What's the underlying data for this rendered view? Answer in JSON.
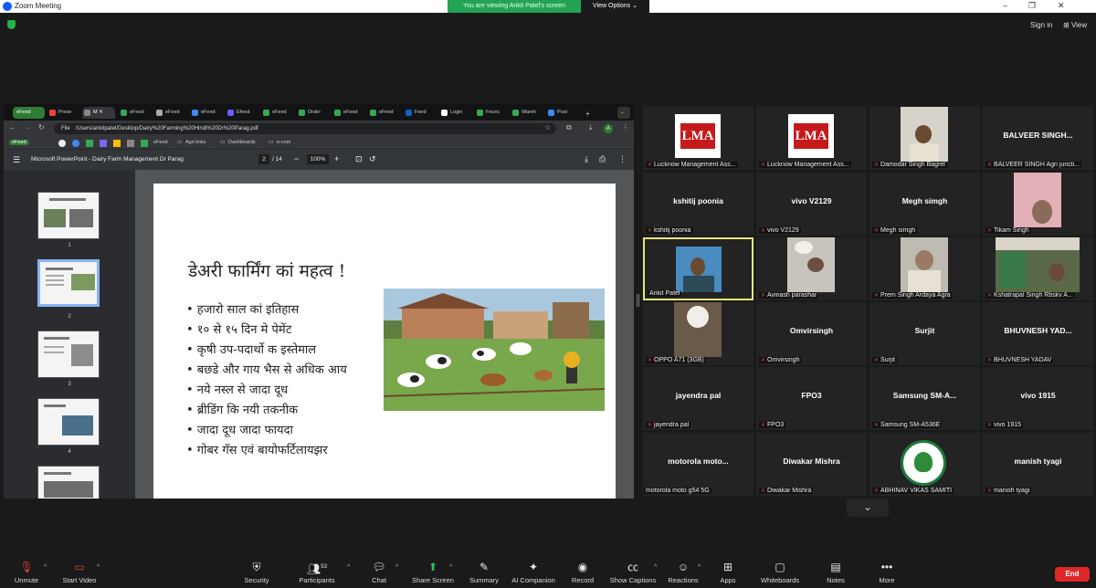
{
  "window": {
    "title": "Zoom Meeting"
  },
  "banner": {
    "viewing": "You are viewing Ankit Patel's screen",
    "view_options": "View Options"
  },
  "header": {
    "sign_in": "Sign in",
    "view": "View"
  },
  "browser": {
    "tabs": [
      {
        "label": "eFeed"
      },
      {
        "label": "Prese"
      },
      {
        "label": "M"
      },
      {
        "label": "eFeed"
      },
      {
        "label": "eFeed"
      },
      {
        "label": "eFeed"
      },
      {
        "label": "Efeed"
      },
      {
        "label": "eFeed"
      },
      {
        "label": "Order"
      },
      {
        "label": "eFeed"
      },
      {
        "label": "eFeed"
      },
      {
        "label": "Feed"
      },
      {
        "label": "Login"
      },
      {
        "label": "Founc"
      },
      {
        "label": "Wareh"
      },
      {
        "label": "Post"
      }
    ],
    "url_prefix": "File",
    "url": "/Users/ankitpatel/Desktop/Dairy%20Farming%20Hindi%20Dr%20Parag.pdf",
    "bookmarks": [
      "eFeed",
      "eFeed",
      "Agri links",
      "Dashboards",
      "e-com"
    ]
  },
  "pdf": {
    "doc_title": "Microsoft PowerPoint - Dairy Farm Management Dr Parag",
    "page_current": "2",
    "page_total": "/ 14",
    "zoom": "100%",
    "thumb_numbers": [
      "1",
      "2",
      "3",
      "4"
    ]
  },
  "slide": {
    "title": "डेअरी फार्मिंग कां महत्व  !",
    "bullets": [
      "• हजारो साल कां  इतिहास",
      "• १० से १५ दिन मे पेमेंट",
      "• कृषी उप-पदार्थो क इस्तेमाल",
      "• बछडे और गाय भैस से अधिक आय",
      "• नये नस्ल से जादा दूध",
      "• ब्रीडिंग कि नयी तकनीक",
      "• जादा दूध जादा फायदा",
      "• गोबर गॅस एवं बायोफर्टिलायझर"
    ]
  },
  "participants": [
    {
      "name": "",
      "label": "Lucknow Management Ass..."
    },
    {
      "name": "",
      "label": "Lucknow Management Ass..."
    },
    {
      "name": "",
      "label": "Damodar Singh Bagrel"
    },
    {
      "name": "BALVEER SINGH...",
      "label": "BALVEER SINGH Agri juncti..."
    },
    {
      "name": "kshitij poonia",
      "label": "kshitij poonia"
    },
    {
      "name": "vivo V2129",
      "label": "vivo V2129"
    },
    {
      "name": "Megh simgh",
      "label": "Megh simgh"
    },
    {
      "name": "",
      "label": "Tikam Singh"
    },
    {
      "name": "",
      "label": "Ankit Patel"
    },
    {
      "name": "",
      "label": "Avinash parashar"
    },
    {
      "name": "",
      "label": "Prem Singh Ardaya Agra"
    },
    {
      "name": "",
      "label": "Kshatrapal Singh Rbskv A..."
    },
    {
      "name": "",
      "label": "OPPO A71 (3GB)"
    },
    {
      "name": "Omvirsingh",
      "label": "Omvirsingh"
    },
    {
      "name": "Surjit",
      "label": "Surjit"
    },
    {
      "name": "BHUVNESH YAD...",
      "label": "BHUVNESH YADAV"
    },
    {
      "name": "jayendra pal",
      "label": "jayendra pal"
    },
    {
      "name": "FPO3",
      "label": "FPO3"
    },
    {
      "name": "Samsung SM-A...",
      "label": "Samsung SM-A536E"
    },
    {
      "name": "vivo 1915",
      "label": "vivo 1915"
    },
    {
      "name": "motorola moto...",
      "label": "motorola moto g54 5G"
    },
    {
      "name": "Diwakar Mishra",
      "label": "Diwakar Mishra"
    },
    {
      "name": "",
      "label": "ABHINAV VIKAS SAMITI"
    },
    {
      "name": "manish tyagi",
      "label": "manish tyagi"
    }
  ],
  "lma_text": "LMA",
  "toolbar": {
    "unmute": "Unmute",
    "start_video": "Start Video",
    "security": "Security",
    "participants": "Participants",
    "participant_count": "53",
    "chat": "Chat",
    "share_screen": "Share Screen",
    "summary": "Summary",
    "ai_companion": "AI Companion",
    "record": "Record",
    "show_captions": "Show Captions",
    "reactions": "Reactions",
    "apps": "Apps",
    "whiteboards": "Whiteboards",
    "notes": "Notes",
    "more": "More",
    "end": "End"
  }
}
